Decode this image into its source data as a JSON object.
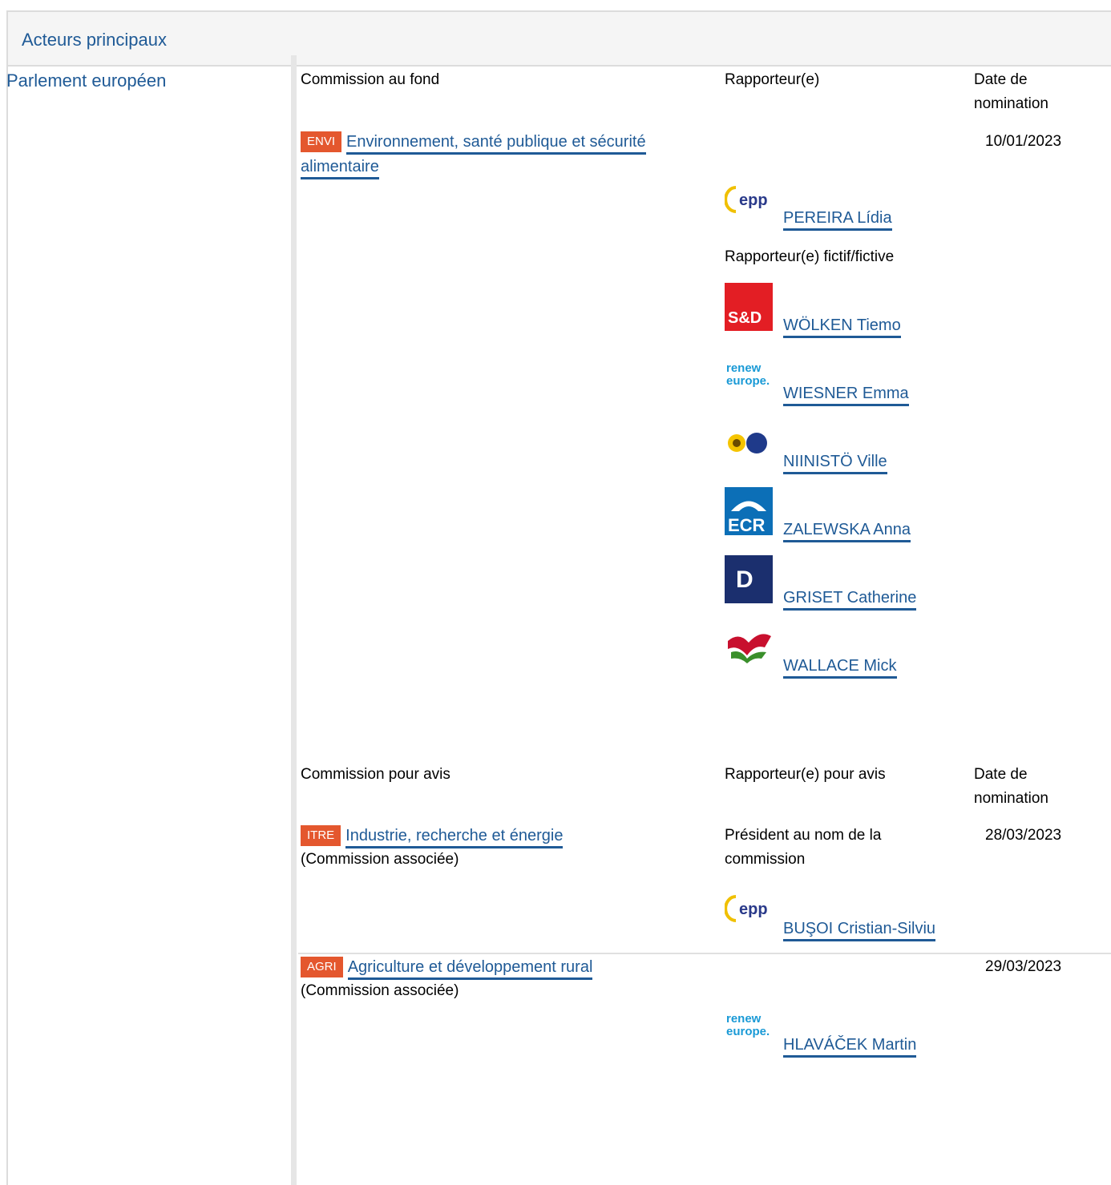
{
  "section": {
    "title": "Acteurs principaux"
  },
  "institution": "Parlement européen",
  "lead": {
    "col_committee": "Commission au fond",
    "col_rapporteur": "Rapporteur(e)",
    "col_date": "Date de nomination",
    "committee": {
      "code": "ENVI",
      "name": "Environnement, santé publique et sécurité alimentaire"
    },
    "date": "10/01/2023",
    "rapporteur": {
      "name": "PEREIRA Lídia",
      "group_icon": "epp-logo-icon"
    },
    "shadow_label": "Rapporteur(e) fictif/fictive",
    "shadows": [
      {
        "name": "WÖLKEN Tiemo",
        "group_icon": "sd-logo-icon"
      },
      {
        "name": "WIESNER Emma",
        "group_icon": "renew-logo-icon"
      },
      {
        "name": "NIINISTÖ Ville",
        "group_icon": "greens-logo-icon"
      },
      {
        "name": "ZALEWSKA Anna",
        "group_icon": "ecr-logo-icon"
      },
      {
        "name": "GRISET Catherine",
        "group_icon": "id-logo-icon"
      },
      {
        "name": "WALLACE Mick",
        "group_icon": "left-logo-icon"
      }
    ]
  },
  "opinion": {
    "col_committee": "Commission pour avis",
    "col_rapporteur": "Rapporteur(e) pour avis",
    "col_date": "Date de nomination",
    "items": [
      {
        "code": "ITRE",
        "name": "Industrie, recherche et énergie",
        "note": "(Commission associée)",
        "role": "Président au nom de la commission",
        "date": "28/03/2023",
        "rapporteur": {
          "name": "BUŞOI Cristian-Silviu",
          "group_icon": "epp-logo-icon"
        }
      },
      {
        "code": "AGRI",
        "name": "Agriculture et développement rural",
        "note": "(Commission associée)",
        "date": "29/03/2023",
        "rapporteur": {
          "name": "HLAVÁČEK Martin",
          "group_icon": "renew-logo-icon"
        }
      }
    ]
  },
  "colors": {
    "accent": "#1f5a96",
    "badge": "#e4572e"
  }
}
